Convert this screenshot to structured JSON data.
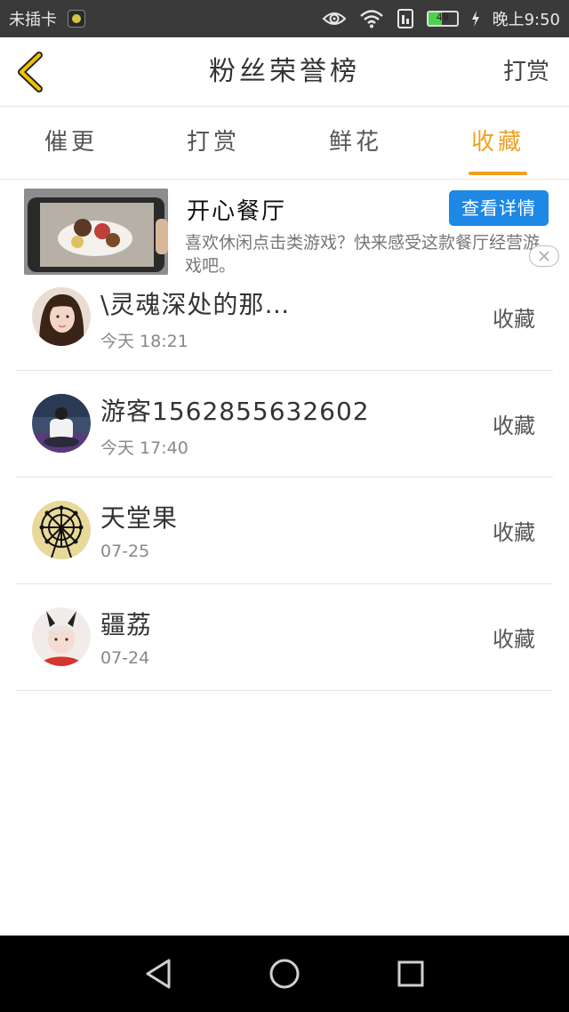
{
  "status_bar": {
    "carrier": "未插卡",
    "battery_level": "49",
    "time": "晚上9:50"
  },
  "header": {
    "title": "粉丝荣誉榜",
    "action": "打赏"
  },
  "tabs": [
    {
      "label": "催更",
      "active": false
    },
    {
      "label": "打赏",
      "active": false
    },
    {
      "label": "鲜花",
      "active": false
    },
    {
      "label": "收藏",
      "active": true
    }
  ],
  "ad": {
    "title": "开心餐厅",
    "button_label": "查看详情",
    "description": "喜欢休闲点击类游戏？快来感受这款餐厅经营游戏吧。"
  },
  "list": [
    {
      "name": "\\灵魂深处的那…",
      "time": "今天 18:21",
      "action": "收藏",
      "avatar_icon": "girl-portrait"
    },
    {
      "name": "游客1562855632602",
      "time": "今天 17:40",
      "action": "收藏",
      "avatar_icon": "person-back-view"
    },
    {
      "name": "天堂果",
      "time": "07-25",
      "action": "收藏",
      "avatar_icon": "ferris-wheel"
    },
    {
      "name": "疆荔",
      "time": "07-24",
      "action": "收藏",
      "avatar_icon": "girl-with-bunny-ears"
    }
  ],
  "colors": {
    "accent": "#f0a020",
    "ad_button": "#1e88e5",
    "status_bar": "#3a3a3a",
    "nav_bar": "#000000"
  }
}
